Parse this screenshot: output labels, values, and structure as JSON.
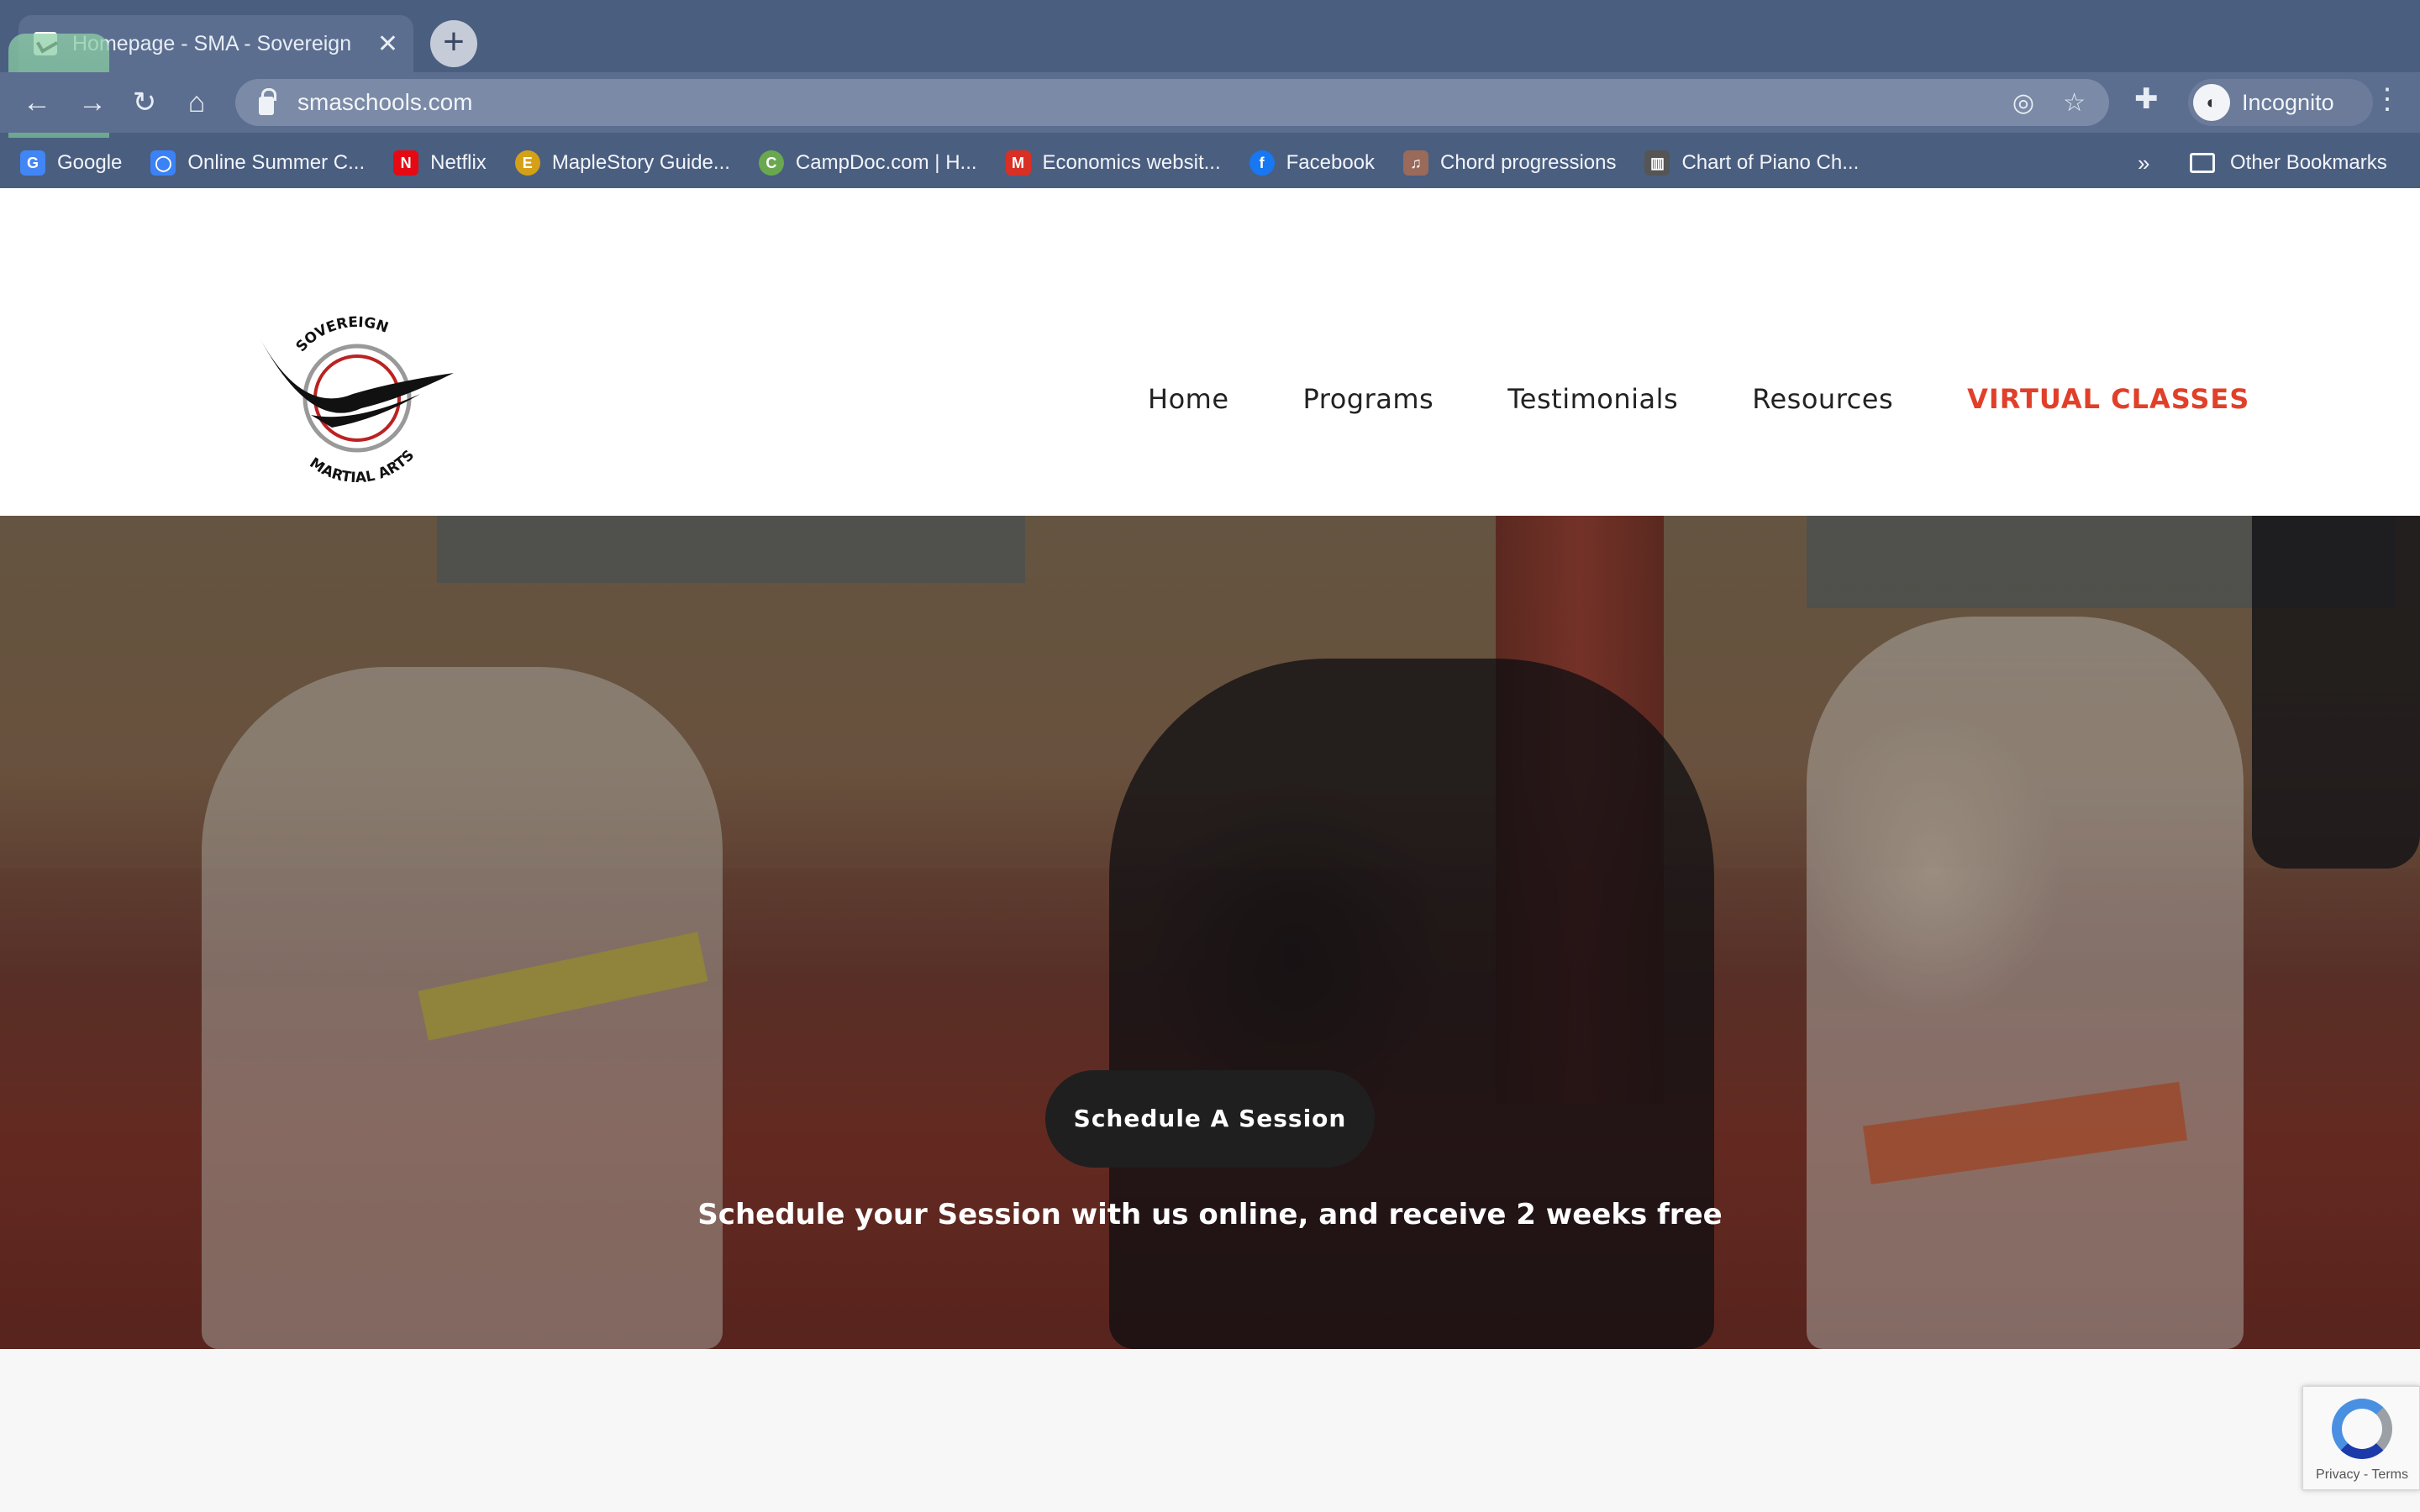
{
  "browser": {
    "tab_title": "Homepage - SMA - Sovereign",
    "tab_close": "✕",
    "new_tab": "+",
    "url": "smaschools.com",
    "profile_label": "Incognito",
    "bookmarks": [
      {
        "label": "Google",
        "icon": "google-icon",
        "color": "#4285f4",
        "glyph": "G"
      },
      {
        "label": "Online Summer C...",
        "icon": "apple-icon",
        "color": "#3b82f6",
        "glyph": "◯"
      },
      {
        "label": "Netflix",
        "icon": "netflix-icon",
        "color": "#e50914",
        "glyph": "N"
      },
      {
        "label": "MapleStory Guide...",
        "icon": "maplestory-icon",
        "color": "#d4a017",
        "glyph": "E"
      },
      {
        "label": "CampDoc.com | H...",
        "icon": "campdoc-icon",
        "color": "#6aa84f",
        "glyph": "C"
      },
      {
        "label": "Economics websit...",
        "icon": "economics-icon",
        "color": "#d93025",
        "glyph": "M"
      },
      {
        "label": "Facebook",
        "icon": "facebook-icon",
        "color": "#1877f2",
        "glyph": "f"
      },
      {
        "label": "Chord progressions",
        "icon": "chord-icon",
        "color": "#9a6a5a",
        "glyph": "♫"
      },
      {
        "label": "Chart of Piano Ch...",
        "icon": "piano-icon",
        "color": "#555555",
        "glyph": "▥"
      }
    ],
    "bookmarks_more": "»",
    "other_bookmarks": "Other Bookmarks"
  },
  "site": {
    "logo_text_top": "SOVEREIGN",
    "logo_text_bottom": "MARTIAL ARTS",
    "nav": [
      {
        "label": "Home"
      },
      {
        "label": "Programs"
      },
      {
        "label": "Testimonials"
      },
      {
        "label": "Resources"
      },
      {
        "label": "VIRTUAL CLASSES"
      }
    ],
    "accent_color": "#e0402a",
    "hero": {
      "cta_label": "Schedule A Session",
      "tagline": "Schedule your Session with us online, and receive 2 weeks free"
    }
  },
  "recaptcha": {
    "label": "Privacy - Terms"
  }
}
